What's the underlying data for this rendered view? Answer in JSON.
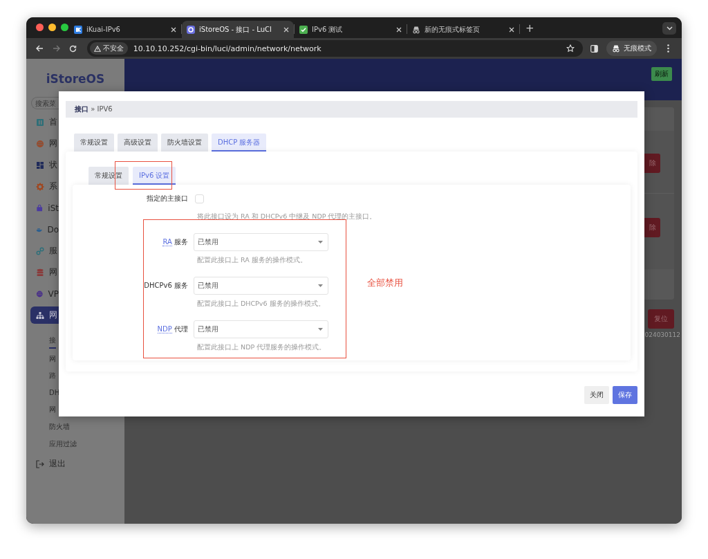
{
  "browser": {
    "tabs": [
      {
        "title": "iKuai-IPv6",
        "kind": "ik",
        "selected": false
      },
      {
        "title": "iStoreOS - 接口 - LuCI",
        "kind": "luci",
        "selected": true
      },
      {
        "title": "IPv6 测试",
        "kind": "check",
        "selected": false
      },
      {
        "title": "新的无痕式标签页",
        "kind": "incognito",
        "selected": false
      }
    ],
    "new_tab_label": "+",
    "forward_disabled": true,
    "security_label": "不安全",
    "url": "10.10.10.252/cgi-bin/luci/admin/network/network",
    "profile_label": "无痕模式"
  },
  "sidebar": {
    "logo": "iStoreOS",
    "search_placeholder": "搜索菜",
    "items": [
      {
        "label": "首",
        "kind": "panel",
        "color": "#2f6f78",
        "selected": false
      },
      {
        "label": "网",
        "kind": "globe",
        "color": "#9a4a2a",
        "selected": false
      },
      {
        "label": "状",
        "kind": "grid",
        "color": "#1f2a5a",
        "selected": false
      },
      {
        "label": "系",
        "kind": "gear",
        "color": "#a0461f",
        "selected": false
      },
      {
        "label": "iSt",
        "kind": "bag",
        "color": "#4a3aa0",
        "selected": false
      },
      {
        "label": "Do",
        "kind": "whale",
        "color": "#2d5f8f",
        "selected": false
      },
      {
        "label": "服",
        "kind": "link",
        "color": "#2d6f7a",
        "selected": false
      },
      {
        "label": "网",
        "kind": "database",
        "color": "#8a3a3a",
        "selected": false
      },
      {
        "label": "VP",
        "kind": "globe",
        "color": "#4a2e8e",
        "selected": false
      },
      {
        "label": "网",
        "kind": "network",
        "color": "#c8c8d8",
        "selected": true
      }
    ],
    "subitems": [
      {
        "label": "接",
        "selected": true
      },
      {
        "label": "网",
        "selected": false
      },
      {
        "label": "路",
        "selected": false
      },
      {
        "label": "DH",
        "selected": false
      },
      {
        "label": "网",
        "selected": false
      },
      {
        "label": "防火墙",
        "selected": false
      },
      {
        "label": "应用过滤",
        "selected": false
      }
    ],
    "logout": "退出"
  },
  "header": {
    "refresh": "刷新"
  },
  "page": {
    "delete_buttons": [
      "除",
      "除"
    ],
    "reset": "复位",
    "version": "024030112"
  },
  "dialog": {
    "breadcrumb": "**接口** » IPV6",
    "tabs": [
      {
        "label": "常规设置",
        "selected": false
      },
      {
        "label": "高级设置",
        "selected": false
      },
      {
        "label": "防火墙设置",
        "selected": false
      },
      {
        "label": "DHCP 服务器",
        "selected": true
      }
    ],
    "subtabs": [
      {
        "label": "常规设置",
        "selected": false
      },
      {
        "label": "IPv6 设置",
        "selected": true
      }
    ],
    "fields": [
      {
        "kind": "checkbox",
        "label": "指定的主接口",
        "abbr": false,
        "checked": false,
        "description": "将此接口设为 RA 和 DHCPv6 中继及 NDP 代理的主接口。"
      },
      {
        "kind": "select",
        "label": "RA 服务",
        "abbr": true,
        "value": "已禁用",
        "description": "配置此接口上 RA 服务的操作模式。"
      },
      {
        "kind": "select",
        "label": "DHCPv6 服务",
        "abbr": false,
        "value": "已禁用",
        "description": "配置此接口上 DHCPv6 服务的操作模式。"
      },
      {
        "kind": "select",
        "label": "NDP 代理",
        "abbr": true,
        "value": "已禁用",
        "description": "配置此接口上 NDP 代理服务的操作模式。"
      }
    ],
    "buttons": [
      {
        "label": "关闭",
        "kind": "secondary"
      },
      {
        "label": "保存",
        "kind": "primary"
      }
    ]
  },
  "annotation": {
    "text": "全部禁用"
  }
}
